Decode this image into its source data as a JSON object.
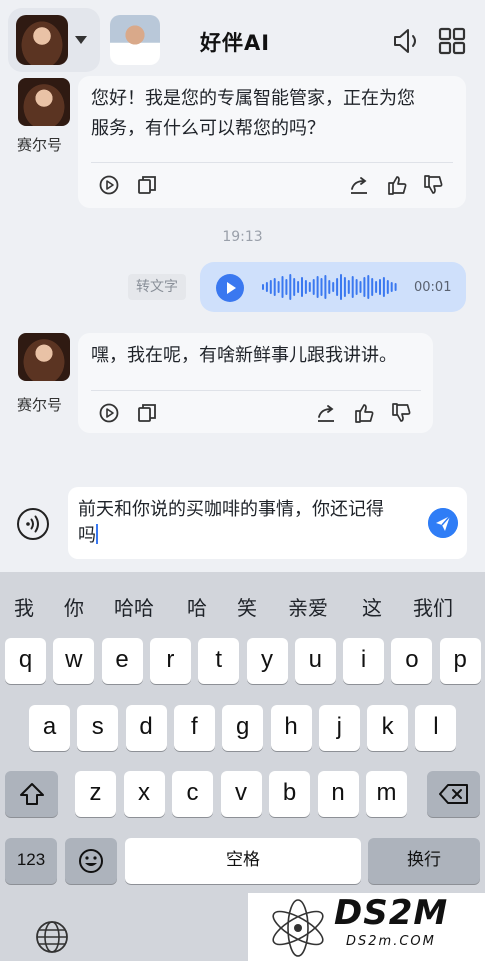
{
  "header": {
    "title": "好伴AI",
    "avatar_current": "female-avatar",
    "avatar_secondary": "male-avatar",
    "icons": [
      "chevron-down-icon",
      "speaker-icon",
      "grid-icon"
    ]
  },
  "messages": [
    {
      "sender": "赛尔号",
      "text_lines": [
        "您好！我是您的专属智能管家，正在为您",
        "服务，有什么可以帮您的吗？"
      ]
    },
    {
      "sender": "赛尔号",
      "text_lines": [
        "嘿，我在呢，有啥新鲜事儿跟我讲讲。"
      ]
    }
  ],
  "timestamp": "19:13",
  "voice_message": {
    "to_text_label": "转文字",
    "duration": "00:01"
  },
  "input": {
    "lines": [
      "前天和你说的买咖啡的事情，你还记得",
      "吗"
    ]
  },
  "keyboard": {
    "candidates": [
      "我",
      "你",
      "哈哈",
      "哈",
      "笑",
      "亲爱",
      "这",
      "我们"
    ],
    "row1": [
      "q",
      "w",
      "e",
      "r",
      "t",
      "y",
      "u",
      "i",
      "o",
      "p"
    ],
    "row2": [
      "a",
      "s",
      "d",
      "f",
      "g",
      "h",
      "j",
      "k",
      "l"
    ],
    "row3": [
      "z",
      "x",
      "c",
      "v",
      "b",
      "n",
      "m"
    ],
    "numbers_label": "123",
    "space_label": "空格",
    "return_label": "换行"
  },
  "watermark": {
    "brand": "DS2M",
    "url": "DS2m.COM"
  },
  "colors": {
    "accent": "#2f7df6",
    "voice_bubble": "#cfe0fb"
  }
}
